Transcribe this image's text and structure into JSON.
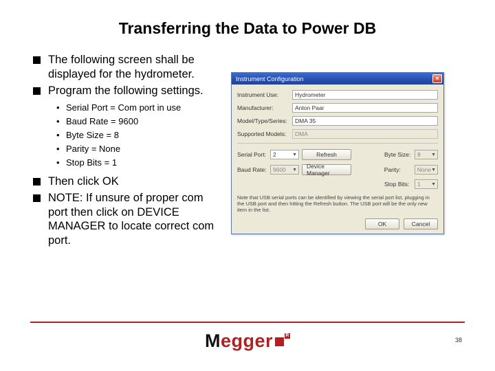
{
  "title": "Transferring the Data to Power DB",
  "bullets1": [
    "The following screen shall be displayed for the hydrometer.",
    "Program the following settings."
  ],
  "subbullets": [
    "Serial Port = Com port in use",
    "Baud Rate = 9600",
    "Byte Size = 8",
    "Parity = None",
    "Stop Bits = 1"
  ],
  "bullets2": [
    "Then click OK",
    "NOTE: If unsure of proper com port then click on DEVICE MANAGER to locate correct com port."
  ],
  "window": {
    "title": "Instrument Configuration",
    "fields": {
      "instrument_use_label": "Instrument Use:",
      "instrument_use_value": "Hydrometer",
      "manufacturer_label": "Manufacturer:",
      "manufacturer_value": "Anton Paar",
      "model_label": "Model/Type/Series:",
      "model_value": "DMA 35",
      "supported_models_label": "Supported Models:",
      "supported_models_value": "DMA"
    },
    "serial": {
      "serial_port_label": "Serial Port:",
      "serial_port_value": "2",
      "refresh_label": "Refresh",
      "byte_size_label": "Byte Size:",
      "byte_size_value": "8",
      "baud_label": "Baud Rate:",
      "baud_value": "9600",
      "device_manager_label": "Device Manager",
      "parity_label": "Parity:",
      "parity_value": "None",
      "stop_bits_label": "Stop Bits:",
      "stop_bits_value": "1"
    },
    "note": "Note that USB serial ports can be identified by viewing the serial port list, plugging in the USB port and then hitting the Refresh button. The USB port will be the only new item in the list.",
    "ok_label": "OK",
    "cancel_label": "Cancel"
  },
  "logo": {
    "part1": "M",
    "part2": "egger"
  },
  "page_number": "38"
}
